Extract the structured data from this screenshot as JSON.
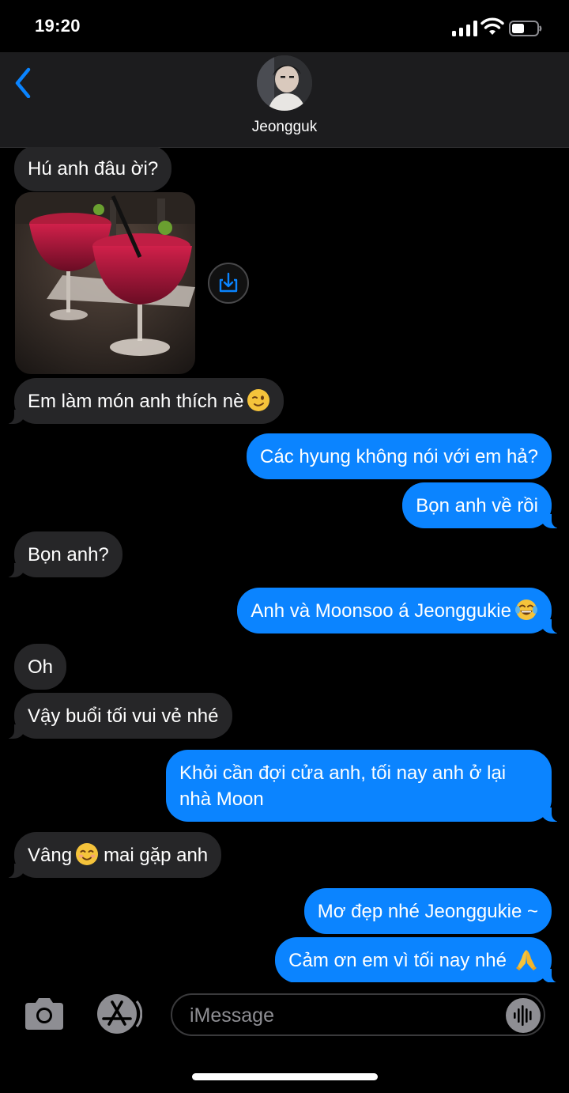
{
  "status_bar": {
    "time": "19:20",
    "signal_icon": "cellular-signal-icon",
    "wifi_icon": "wifi-icon",
    "battery_icon": "battery-icon"
  },
  "header": {
    "back_icon": "chevron-left-icon",
    "contact_name": "Jeongguk"
  },
  "messages": [
    {
      "side": "in",
      "text": "Hú anh đâu ời?"
    },
    {
      "side": "in",
      "type": "image",
      "description_icon": "photo-attachment",
      "share_icon": "save-download-icon"
    },
    {
      "side": "in",
      "text": "Em làm món anh thích nè",
      "emoji": "winking-face"
    },
    {
      "side": "out",
      "text": "Các hyung không nói với em hả?"
    },
    {
      "side": "out",
      "text": "Bọn anh về rồi"
    },
    {
      "side": "in",
      "text": "Bọn anh?"
    },
    {
      "side": "out",
      "text": "Anh và Moonsoo á Jeonggukie",
      "emoji": "tears-of-joy-face"
    },
    {
      "side": "in",
      "text": "Oh"
    },
    {
      "side": "in",
      "text": "Vậy buổi tối vui vẻ nhé"
    },
    {
      "side": "out",
      "text": "Khỏi cần đợi cửa anh, tối nay anh ở lại nhà Moon"
    },
    {
      "side": "in",
      "text_before": "Vâng",
      "emoji": "smiling-face",
      "text_after": "mai gặp anh"
    },
    {
      "side": "out",
      "text": "Mơ đẹp nhé Jeonggukie ~"
    },
    {
      "side": "out",
      "text": "Cảm ơn em vì tối nay nhé",
      "emoji": "folded-hands"
    }
  ],
  "input_bar": {
    "camera_icon": "camera-icon",
    "apps_icon": "app-store-icon",
    "placeholder": "iMessage",
    "audio_icon": "audio-waveform-icon"
  },
  "colors": {
    "background": "#000000",
    "header_bg": "#1c1c1e",
    "incoming_bubble": "#262628",
    "outgoing_bubble": "#0b84ff",
    "accent": "#0a84ff"
  }
}
